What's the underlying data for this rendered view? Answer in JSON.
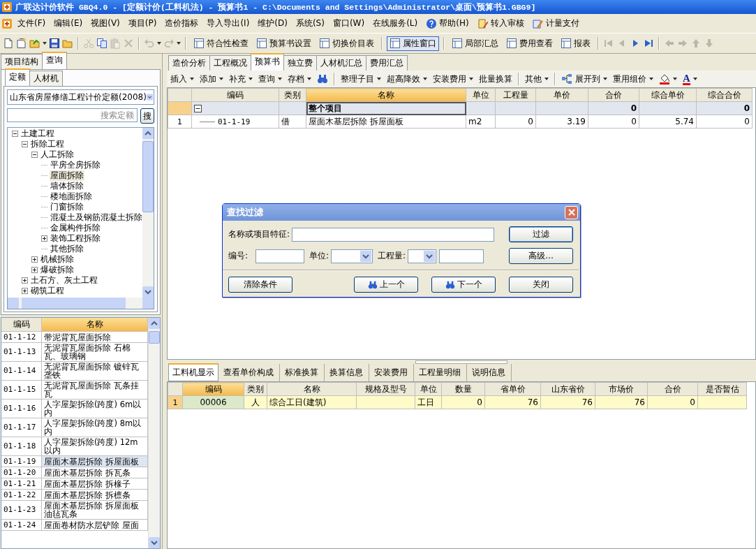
{
  "window": {
    "title": "广联达计价软件 GBQ4.0 - [定额计价(工料机法) - 预算书1 - C:\\Documents and Settings\\Administrator\\桌面\\预算书1.GBG9]"
  },
  "menu": [
    {
      "label": "文件(F)",
      "kind": "text"
    },
    {
      "label": "编辑(E)",
      "kind": "text"
    },
    {
      "label": "视图(V)",
      "kind": "text"
    },
    {
      "label": "项目(P)",
      "kind": "text"
    },
    {
      "label": "造价指标",
      "kind": "text"
    },
    {
      "label": "导入导出(I)",
      "kind": "text"
    },
    {
      "label": "维护(D)",
      "kind": "text"
    },
    {
      "label": "系统(S)",
      "kind": "text"
    },
    {
      "label": "窗口(W)",
      "kind": "text"
    },
    {
      "label": "在线服务(L)",
      "kind": "text"
    },
    {
      "label": "帮助(H)",
      "kind": "help"
    },
    {
      "label": "转入审核",
      "kind": "review"
    },
    {
      "label": "计量支付",
      "kind": "pay"
    }
  ],
  "toolbar": [
    {
      "kind": "new",
      "disabled": false
    },
    {
      "kind": "open",
      "disabled": false
    },
    {
      "kind": "open-folder",
      "disabled": false,
      "dropdown": true
    },
    {
      "kind": "save",
      "disabled": false
    },
    {
      "kind": "folder",
      "disabled": false
    },
    {
      "kind": "sep"
    },
    {
      "kind": "cut",
      "disabled": true
    },
    {
      "kind": "copy",
      "disabled": false
    },
    {
      "kind": "paste",
      "disabled": true
    },
    {
      "kind": "delete",
      "disabled": true
    },
    {
      "kind": "sep"
    },
    {
      "kind": "undo",
      "disabled": true,
      "dropdown": true
    },
    {
      "kind": "redo",
      "disabled": true,
      "dropdown": true
    },
    {
      "kind": "sep"
    },
    {
      "kind": "button",
      "label": "符合性检查",
      "selected": false
    },
    {
      "kind": "button",
      "label": "预算书设置",
      "selected": false
    },
    {
      "kind": "button",
      "label": "切换价目表",
      "selected": false
    },
    {
      "kind": "sep"
    },
    {
      "kind": "button",
      "label": "属性窗口",
      "selected": true
    },
    {
      "kind": "sep"
    },
    {
      "kind": "button",
      "label": "局部汇总",
      "selected": false
    },
    {
      "kind": "button",
      "label": "费用查看",
      "selected": false
    },
    {
      "kind": "button",
      "label": "报表",
      "selected": false
    },
    {
      "kind": "sep"
    },
    {
      "kind": "first",
      "disabled": true
    },
    {
      "kind": "prev",
      "disabled": true
    },
    {
      "kind": "next",
      "disabled": false
    },
    {
      "kind": "last",
      "disabled": false
    },
    {
      "kind": "sep"
    },
    {
      "kind": "left",
      "disabled": true
    },
    {
      "kind": "right",
      "disabled": true
    },
    {
      "kind": "up",
      "disabled": true
    },
    {
      "kind": "down",
      "disabled": true
    }
  ],
  "left_panel": {
    "tabs": [
      {
        "label": "项目结构",
        "selected": false
      },
      {
        "label": "查询",
        "selected": true
      }
    ],
    "sub_tabs": [
      {
        "label": "定额",
        "selected": true
      },
      {
        "label": "人材机",
        "selected": false
      }
    ],
    "library": {
      "value": "山东省房屋修缮工程计价定额(2008)"
    },
    "search": {
      "placeholder": "搜索定额",
      "button": "搜"
    },
    "tree": [
      {
        "label": "土建工程",
        "expanded": true,
        "selected": false,
        "children": [
          {
            "label": "拆除工程",
            "expanded": true,
            "selected": false,
            "children": [
              {
                "label": "人工拆除",
                "expanded": true,
                "selected": false,
                "children": [
                  {
                    "label": "平房全房拆除",
                    "selected": false
                  },
                  {
                    "label": "屋面拆除",
                    "selected": true
                  },
                  {
                    "label": "墙体拆除",
                    "selected": false
                  },
                  {
                    "label": "楼地面拆除",
                    "selected": false
                  },
                  {
                    "label": "门窗拆除",
                    "selected": false
                  },
                  {
                    "label": "混凝土及钢筋混凝土拆除",
                    "selected": false
                  },
                  {
                    "label": "金属构件拆除",
                    "selected": false
                  },
                  {
                    "label": "装饰工程拆除",
                    "expanded": false,
                    "selected": false
                  },
                  {
                    "label": "其他拆除",
                    "selected": false
                  }
                ]
              },
              {
                "label": "机械拆除",
                "expanded": false,
                "selected": false
              },
              {
                "label": "爆破拆除",
                "expanded": false,
                "selected": false
              }
            ]
          },
          {
            "label": "土石方、灰土工程",
            "expanded": false,
            "selected": false
          },
          {
            "label": "砌筑工程",
            "expanded": false,
            "selected": false
          }
        ]
      }
    ],
    "quota_list": {
      "columns": [
        {
          "label": "编码",
          "selected": false
        },
        {
          "label": "名称",
          "selected": true
        }
      ],
      "rows": [
        {
          "code": "01-1-12",
          "name": "带泥背瓦屋面拆除",
          "selected": false
        },
        {
          "code": "01-1-13",
          "name": "无泥背瓦屋面拆除 石棉瓦、玻璃钢",
          "selected": false
        },
        {
          "code": "01-1-14",
          "name": "无泥背瓦屋面拆除 镀锌瓦垄铁",
          "selected": false
        },
        {
          "code": "01-1-15",
          "name": "无泥背瓦屋面拆除 瓦条挂瓦",
          "selected": false
        },
        {
          "code": "01-1-16",
          "name": "人字屋架拆除(跨度) 6m以内",
          "selected": false
        },
        {
          "code": "01-1-17",
          "name": "人字屋架拆除(跨度) 8m以内",
          "selected": false
        },
        {
          "code": "01-1-18",
          "name": "人字屋架拆除(跨度) 12m以内",
          "selected": false
        },
        {
          "code": "01-1-19",
          "name": "屋面木基层拆除 拆屋面板",
          "selected": true
        },
        {
          "code": "01-1-20",
          "name": "屋面木基层拆除 拆瓦条",
          "selected": false
        },
        {
          "code": "01-1-21",
          "name": "屋面木基层拆除 拆椽子",
          "selected": false
        },
        {
          "code": "01-1-22",
          "name": "屋面木基层拆除 拆檩条",
          "selected": false
        },
        {
          "code": "01-1-23",
          "name": "屋面木基层拆除 拆屋面板油毡瓦条",
          "selected": false
        },
        {
          "code": "01-1-24",
          "name": "屋面卷材防水层铲除 屋面",
          "selected": false
        }
      ]
    }
  },
  "main": {
    "tabs": [
      {
        "label": "造价分析",
        "selected": false
      },
      {
        "label": "工程概况",
        "selected": false
      },
      {
        "label": "预算书",
        "selected": true
      },
      {
        "label": "独立费",
        "selected": false
      },
      {
        "label": "人材机汇总",
        "selected": false
      },
      {
        "label": "费用汇总",
        "selected": false
      }
    ],
    "grid_toolbar": [
      {
        "kind": "menu",
        "label": "插入",
        "dropdown": true
      },
      {
        "kind": "menu",
        "label": "添加",
        "dropdown": true
      },
      {
        "kind": "menu",
        "label": "补充",
        "dropdown": true
      },
      {
        "kind": "menu",
        "label": "查询",
        "dropdown": true
      },
      {
        "kind": "menu",
        "label": "存档",
        "dropdown": true
      },
      {
        "kind": "find"
      },
      {
        "kind": "sep"
      },
      {
        "kind": "menu",
        "label": "整理子目",
        "dropdown": true
      },
      {
        "kind": "menu",
        "label": "超高降效",
        "dropdown": true
      },
      {
        "kind": "menu",
        "label": "安装费用",
        "dropdown": true
      },
      {
        "kind": "menu",
        "label": "批量换算",
        "dropdown": false
      },
      {
        "kind": "sep"
      },
      {
        "kind": "menu",
        "label": "其他",
        "dropdown": true
      },
      {
        "kind": "sep"
      },
      {
        "kind": "expand",
        "label": "展开到",
        "dropdown": true
      },
      {
        "kind": "menu",
        "label": "重用组价",
        "dropdown": true
      },
      {
        "kind": "fill",
        "dropdown": true
      },
      {
        "kind": "font-color",
        "label": "A",
        "dropdown": true
      }
    ],
    "budget_grid": {
      "columns": [
        {
          "label": "编码",
          "selected": false
        },
        {
          "label": "类别",
          "selected": false
        },
        {
          "label": "名称",
          "selected": true
        },
        {
          "label": "单位",
          "selected": false
        },
        {
          "label": "工程量",
          "selected": false
        },
        {
          "label": "单价",
          "selected": false
        },
        {
          "label": "合价",
          "selected": false
        },
        {
          "label": "综合单价",
          "selected": false
        },
        {
          "label": "综合合价",
          "selected": false
        }
      ],
      "rows": [
        {
          "kind": "group",
          "expanded": true,
          "selected": true,
          "cells": [
            null,
            null,
            "整个项目",
            null,
            null,
            null,
            "0",
            null,
            "0"
          ]
        },
        {
          "kind": "item",
          "number": "1",
          "selected": false,
          "cells": [
            "01-1-19",
            "借",
            "屋面木基层拆除 拆屋面板",
            "m2",
            "0",
            "3.19",
            "0",
            "5.74",
            "0"
          ]
        }
      ]
    },
    "detail_tabs": [
      {
        "label": "工料机显示",
        "selected": true
      },
      {
        "label": "查看单价构成",
        "selected": false
      },
      {
        "label": "标准换算",
        "selected": false
      },
      {
        "label": "换算信息",
        "selected": false
      },
      {
        "label": "安装费用",
        "selected": false
      },
      {
        "label": "工程量明细",
        "selected": false
      },
      {
        "label": "说明信息",
        "selected": false
      }
    ],
    "detail_grid": {
      "columns": [
        {
          "label": "编码",
          "selected": true
        },
        {
          "label": "类别",
          "selected": false
        },
        {
          "label": "名称",
          "selected": false
        },
        {
          "label": "规格及型号",
          "selected": false
        },
        {
          "label": "单位",
          "selected": false
        },
        {
          "label": "数量",
          "selected": false
        },
        {
          "label": "省单价",
          "selected": false
        },
        {
          "label": "山东省价",
          "selected": false
        },
        {
          "label": "市场价",
          "selected": false
        },
        {
          "label": "合价",
          "selected": false
        },
        {
          "label": "是否暂估",
          "selected": false
        }
      ],
      "rows": [
        {
          "number": "1",
          "selected": true,
          "cells": [
            "00006",
            "人",
            "综合工日(建筑)",
            null,
            "工日",
            "0",
            "76",
            "76",
            "76",
            "0",
            null
          ]
        }
      ]
    }
  },
  "find_dialog": {
    "title": "查找过滤",
    "name_label": "名称或项目特征:",
    "code_label": "编号:",
    "unit_label": "单位:",
    "qty_label": "工程量:",
    "filter_button": "过滤",
    "advanced_button": "高级…",
    "clear_button": "清除条件",
    "prev_button": "上一个",
    "next_button": "下一个",
    "close_button": "关闭"
  }
}
